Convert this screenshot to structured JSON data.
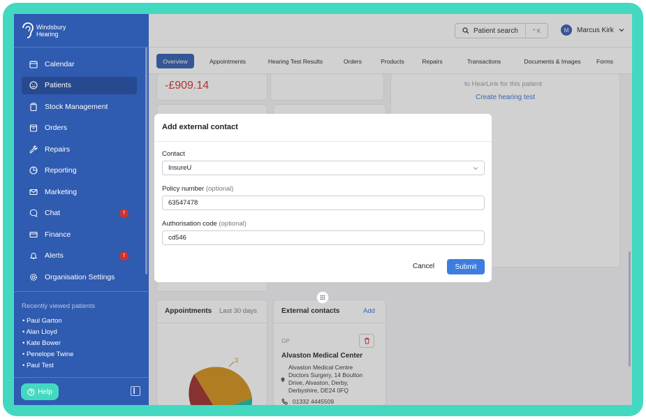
{
  "brand": {
    "line1": "Windsbury",
    "line2": "Hearing"
  },
  "nav": [
    {
      "label": "Calendar",
      "icon": "calendar-icon"
    },
    {
      "label": "Patients",
      "icon": "smile-icon",
      "active": true
    },
    {
      "label": "Stock Management",
      "icon": "clipboard-icon"
    },
    {
      "label": "Orders",
      "icon": "box-icon"
    },
    {
      "label": "Repairs",
      "icon": "wrench-icon"
    },
    {
      "label": "Reporting",
      "icon": "pie-chart-icon"
    },
    {
      "label": "Marketing",
      "icon": "mail-icon"
    },
    {
      "label": "Chat",
      "icon": "chat-icon",
      "badge": "7"
    },
    {
      "label": "Finance",
      "icon": "card-icon"
    },
    {
      "label": "Alerts",
      "icon": "bell-icon",
      "badge": "7"
    },
    {
      "label": "Organisation Settings",
      "icon": "gear-icon"
    }
  ],
  "recent": {
    "title": "Recently viewed patients",
    "items": [
      "• Paul Garton",
      "• Alan Lloyd",
      "• Kate Bower",
      "• Penelope Twine",
      "• Paul Test"
    ]
  },
  "help_label": "Help",
  "topbar": {
    "search_label": "Patient search",
    "shortcut": "^ K",
    "user_initial": "M",
    "user_name": "Marcus Kirk"
  },
  "tabs": [
    "Overview",
    "Appointments",
    "Hearing Test Results",
    "Orders",
    "Products",
    "Repairs",
    "Transactions",
    "Documents & Images",
    "Forms"
  ],
  "background": {
    "balance": "-£909.14",
    "hearlink_text": "to HearLink for this patient",
    "create_hearing_test": "Create hearing test",
    "appointments_title": "Appointments",
    "appointments_period": "Last 30 days",
    "pie_label": "3",
    "external_title": "External contacts",
    "external_add": "Add",
    "gp_label": "GP",
    "gp_name": "Alvaston Medical Center",
    "gp_address": [
      "Alvaston Medical Centre",
      "Doctors Surgery, 14 Boulton",
      "Drive, Alvaston, Derby,",
      "Derbyshire, DE24 0FQ"
    ],
    "gp_phone": "01332 4445509"
  },
  "modal": {
    "title": "Add external contact",
    "contact_label": "Contact",
    "contact_value": "InsureU",
    "policy_label": "Policy number",
    "policy_optional": "(optional)",
    "policy_value": "63547478",
    "auth_label": "Authorisation code",
    "auth_optional": "(optional)",
    "auth_value": "cd546",
    "cancel": "Cancel",
    "submit": "Submit"
  },
  "colors": {
    "sidebar": "#2f5bb0",
    "accent": "#3d7de0",
    "badge": "#c9342f",
    "frame": "#43d9c1",
    "danger": "#d0302b"
  }
}
